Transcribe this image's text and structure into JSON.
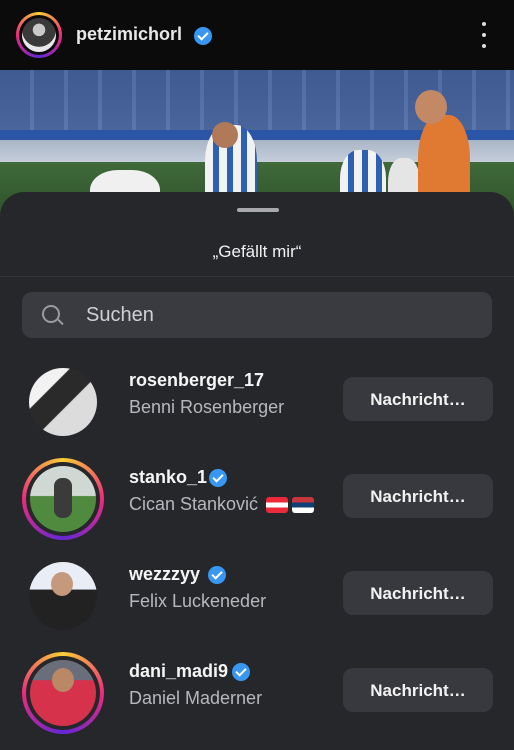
{
  "header": {
    "username": "petzimichorl",
    "verified_icon": "verified-badge-icon",
    "more_icon": "more-vertical-icon"
  },
  "sheet": {
    "title": "„Gefällt mir“",
    "search_placeholder": "Suchen"
  },
  "likes": [
    {
      "username": "rosenberger_17",
      "full_name": "Benni Rosenberger",
      "verified": false,
      "story_ring": false,
      "flags": [],
      "button": "Nachricht…"
    },
    {
      "username": "stanko_1",
      "full_name": "Cican Stanković",
      "verified": true,
      "story_ring": true,
      "flags": [
        "AT",
        "RS"
      ],
      "button": "Nachricht…"
    },
    {
      "username": "wezzzyy",
      "full_name": "Felix Luckeneder",
      "verified": true,
      "story_ring": false,
      "flags": [],
      "button": "Nachricht…"
    },
    {
      "username": "dani_madi9",
      "full_name": "Daniel Maderner",
      "verified": true,
      "story_ring": true,
      "flags": [],
      "button": "Nachricht…"
    }
  ],
  "colors": {
    "sheet_bg": "#26272b",
    "button_bg": "#38393e",
    "verified": "#3897f0"
  }
}
